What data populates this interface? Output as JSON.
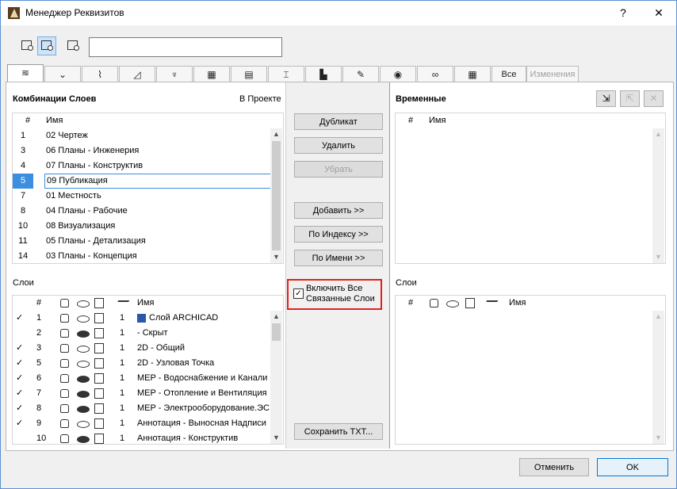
{
  "window": {
    "title": "Менеджер Реквизитов",
    "help_glyph": "?",
    "close_glyph": "✕"
  },
  "toolbar": {
    "search_value": ""
  },
  "tabs": [
    {
      "icon": "layers-icon",
      "glyph": "≋"
    },
    {
      "icon": "pen-icon",
      "glyph": "⌄"
    },
    {
      "icon": "line-type-icon",
      "glyph": "⌇"
    },
    {
      "icon": "fill-icon",
      "glyph": "◿"
    },
    {
      "icon": "brush-icon",
      "glyph": "♆"
    },
    {
      "icon": "composite-icon",
      "glyph": "▦"
    },
    {
      "icon": "profile-icon",
      "glyph": "▤"
    },
    {
      "icon": "beam-icon",
      "glyph": "⌶"
    },
    {
      "icon": "zone-icon",
      "glyph": "▙"
    },
    {
      "icon": "surface-icon",
      "glyph": "✎"
    },
    {
      "icon": "globe-icon",
      "glyph": "◉"
    },
    {
      "icon": "link-icon",
      "glyph": "∞"
    },
    {
      "icon": "table-icon",
      "glyph": "▦"
    }
  ],
  "tab_all": "Все",
  "tab_changes": "Изменения",
  "left": {
    "combos_title": "Комбинации Слоев",
    "in_project": "В Проекте",
    "hdr_num": "#",
    "hdr_name": "Имя",
    "combos": [
      {
        "num": "1",
        "name": "02 Чертеж"
      },
      {
        "num": "3",
        "name": "06 Планы - Инженерия"
      },
      {
        "num": "4",
        "name": "07 Планы - Конструктив"
      },
      {
        "num": "5",
        "name": "09 Публикация",
        "selected": true
      },
      {
        "num": "7",
        "name": "01 Местность"
      },
      {
        "num": "8",
        "name": "04 Планы - Рабочие"
      },
      {
        "num": "10",
        "name": "08 Визуализация"
      },
      {
        "num": "11",
        "name": "05 Планы - Детализация"
      },
      {
        "num": "14",
        "name": "03 Планы - Концепция"
      }
    ],
    "layers_title": "Слои",
    "layers_hdr_num": "#",
    "layers_hdr_name": "Имя",
    "layers": [
      {
        "check": "✓",
        "num": "1",
        "lock": false,
        "vis": true,
        "pen": "1",
        "name": "Слой ARCHICAD",
        "archicad": true
      },
      {
        "check": "",
        "num": "2",
        "lock": false,
        "vis": false,
        "pen": "1",
        "name": "- Скрыт"
      },
      {
        "check": "✓",
        "num": "3",
        "lock": false,
        "vis": true,
        "pen": "1",
        "name": "2D - Общий"
      },
      {
        "check": "✓",
        "num": "5",
        "lock": false,
        "vis": true,
        "pen": "1",
        "name": "2D - Узловая Точка"
      },
      {
        "check": "✓",
        "num": "6",
        "lock": true,
        "vis": false,
        "pen": "1",
        "name": "MEP - Водоснабжение и Канали"
      },
      {
        "check": "✓",
        "num": "7",
        "lock": true,
        "vis": false,
        "pen": "1",
        "name": "MEP - Отопление и Вентиляция"
      },
      {
        "check": "✓",
        "num": "8",
        "lock": true,
        "vis": false,
        "pen": "1",
        "name": "MEP - Электрооборудование.ЭС"
      },
      {
        "check": "✓",
        "num": "9",
        "lock": false,
        "vis": true,
        "pen": "1",
        "name": "Аннотация - Выносная Надписи"
      },
      {
        "check": "",
        "num": "10",
        "lock": false,
        "vis": false,
        "pen": "1",
        "name": "Аннотация - Конструктив"
      }
    ]
  },
  "middle": {
    "duplicate": "Дубликат",
    "delete": "Удалить",
    "remove": "Убрать",
    "add": "Добавить >>",
    "by_index": "По Индексу >>",
    "by_name": "По Имени >>",
    "include_linked": "Включить Все Связанные Слои",
    "include_checked": "✓",
    "save_txt": "Сохранить TXT..."
  },
  "right": {
    "temp_title": "Временные",
    "hdr_num": "#",
    "hdr_name": "Имя",
    "layers_title": "Слои",
    "layers_hdr_num": "#",
    "layers_hdr_name": "Имя"
  },
  "footer": {
    "cancel": "Отменить",
    "ok": "OK"
  }
}
